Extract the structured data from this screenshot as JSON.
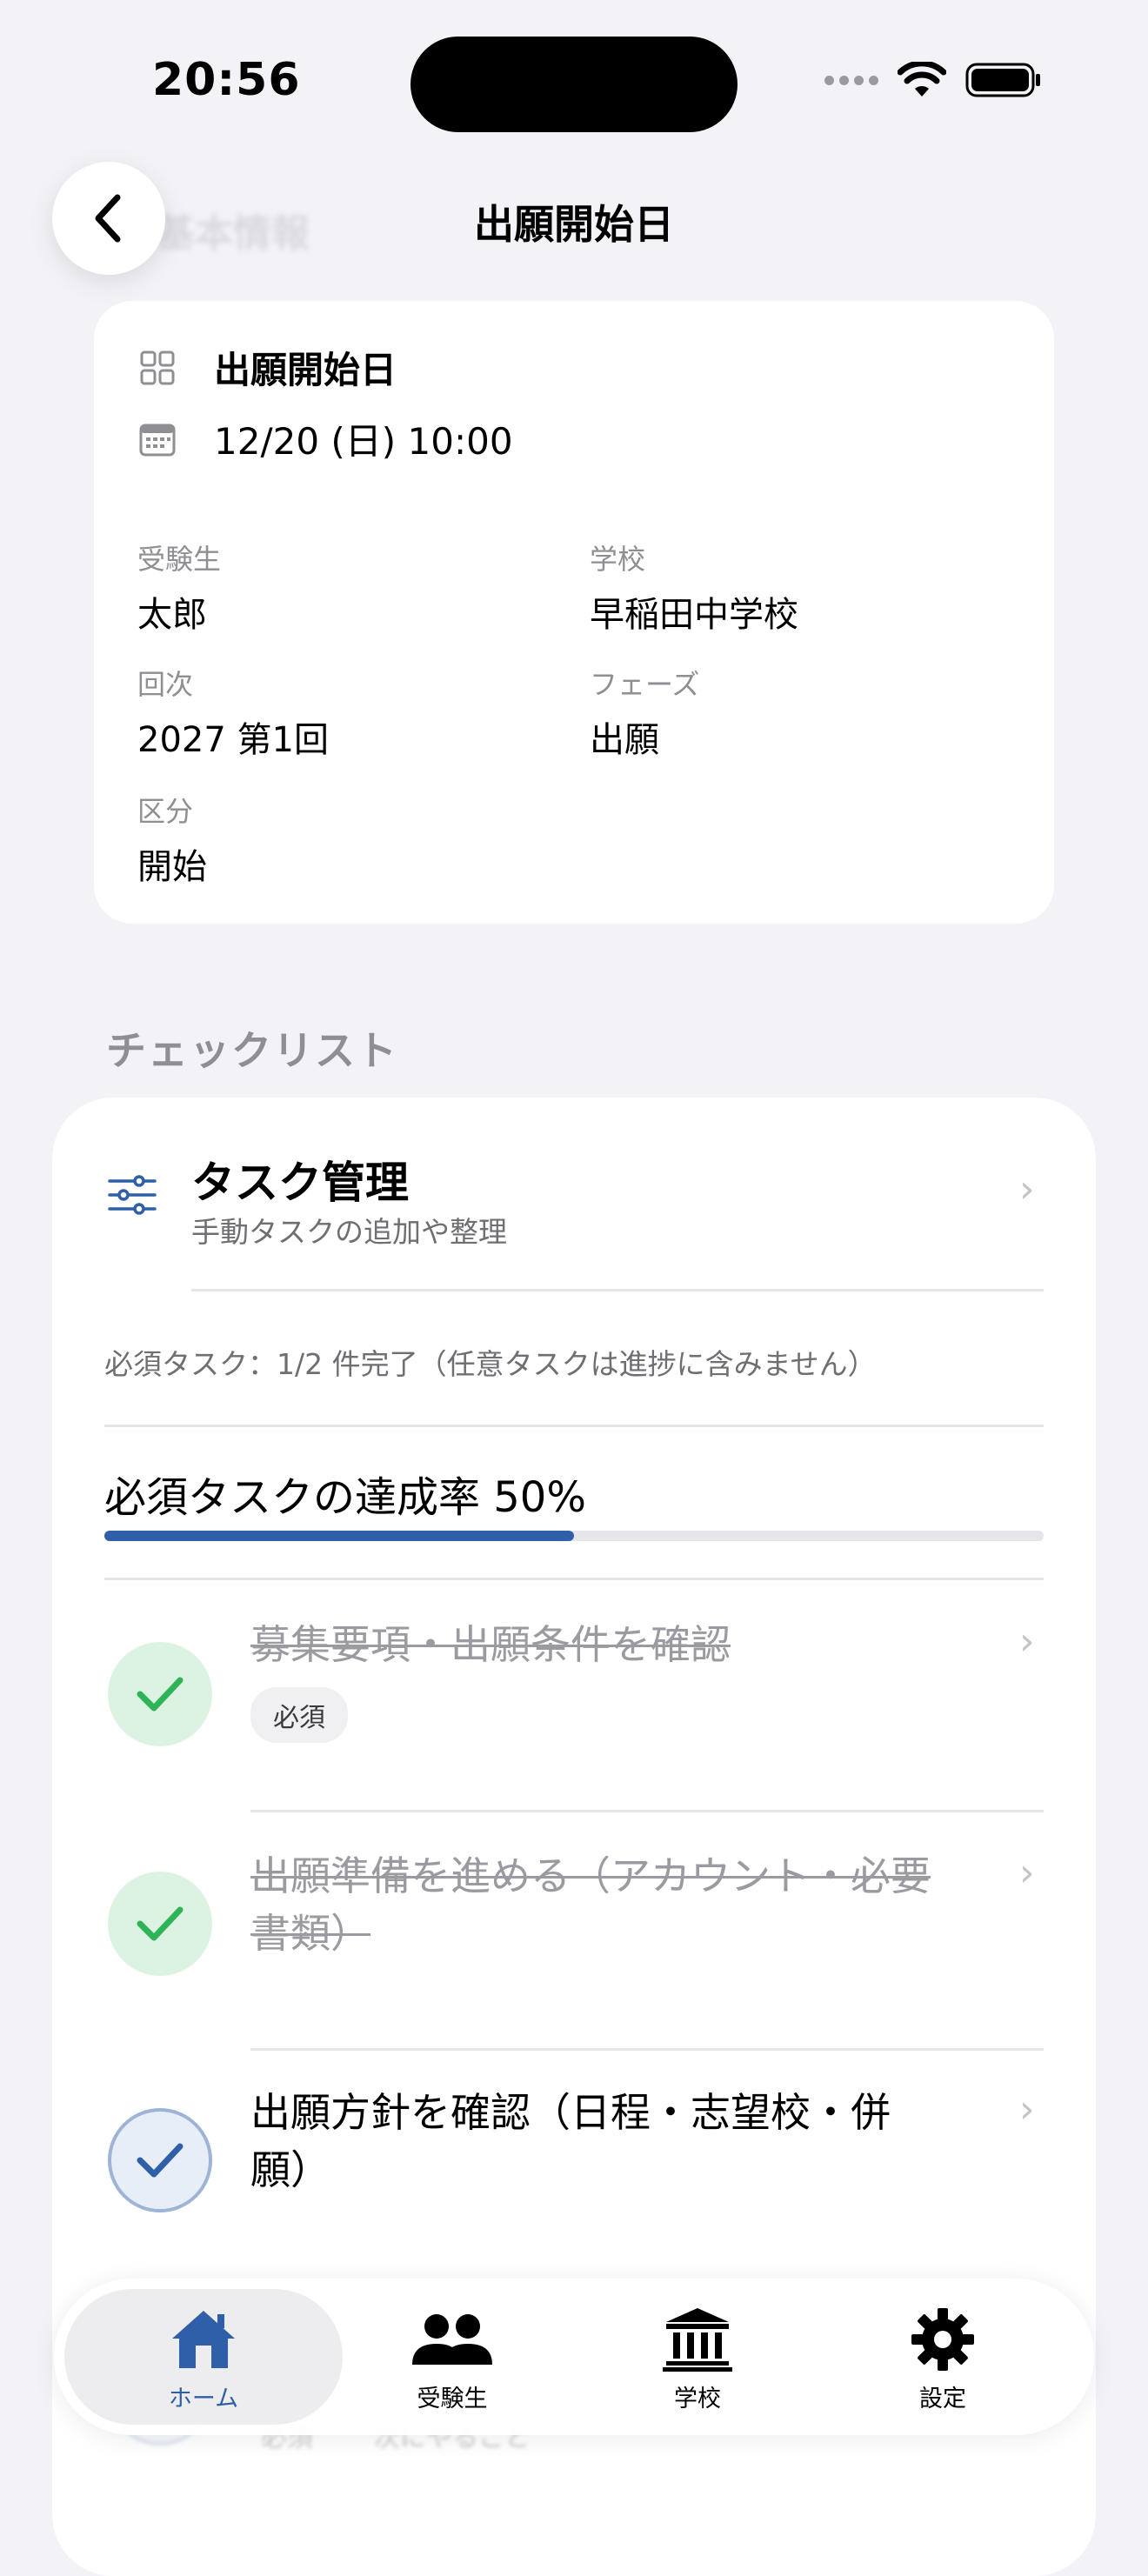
{
  "status_bar": {
    "time": "20:56"
  },
  "header": {
    "title": "出願開始日",
    "ghost_title": "基本情報"
  },
  "event": {
    "name": "出願開始日",
    "datetime": "12/20 (日) 10:00",
    "fields": {
      "student_label": "受験生",
      "student_value": "太郎",
      "school_label": "学校",
      "school_value": "早稲田中学校",
      "round_label": "回次",
      "round_value": "2027 第1回",
      "phase_label": "フェーズ",
      "phase_value": "出願",
      "kind_label": "区分",
      "kind_value": "開始"
    }
  },
  "checklist": {
    "section_title": "チェックリスト",
    "task_management": {
      "title": "タスク管理",
      "subtitle": "手動タスクの追加や整理"
    },
    "summary": "必須タスク：1/2 件完了（任意タスクは進捗に含みません）",
    "progress_label": "必須タスクの達成率 50%",
    "progress_fraction": 0.5,
    "tasks": [
      {
        "title": "募集要項・出願条件を確認",
        "badge": "必須",
        "status": "done"
      },
      {
        "title": "出願準備を進める（アカウント・必要書類）",
        "status": "done"
      },
      {
        "title": "出願方針を確認（日程・志望校・併願）",
        "status": "in_progress"
      }
    ],
    "hidden_tail": {
      "badge": "必須",
      "note": "次にやること"
    }
  },
  "tabbar": {
    "tabs": [
      {
        "label": "ホーム",
        "icon": "house-icon",
        "active": true
      },
      {
        "label": "受験生",
        "icon": "people-icon",
        "active": false
      },
      {
        "label": "学校",
        "icon": "school-building-icon",
        "active": false
      },
      {
        "label": "設定",
        "icon": "gear-icon",
        "active": false
      }
    ]
  },
  "colors": {
    "accent": "#2F5FA8",
    "done_green": "#2EB356",
    "background": "#F2F2F7"
  }
}
